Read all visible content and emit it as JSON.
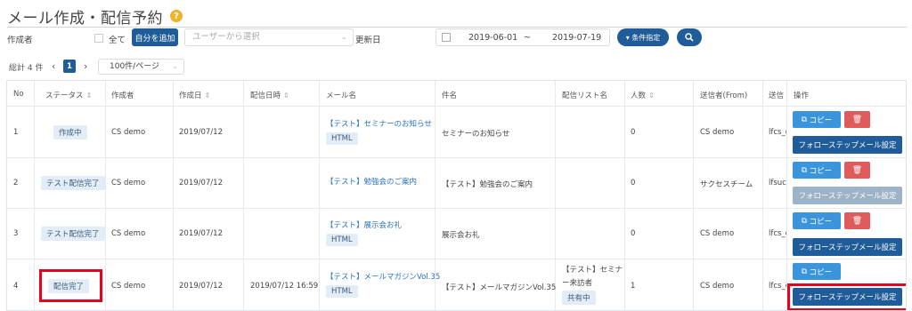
{
  "header": {
    "title": "メール作成・配信予約",
    "help": "?"
  },
  "filters": {
    "creator_label": "作成者",
    "all_label": "全て",
    "add_self_label": "自分を追加",
    "user_select_placeholder": "ユーザーから選択",
    "updated_label": "更新日",
    "date_from": "2019-06-01",
    "date_sep": "~",
    "date_to": "2019-07-19",
    "condition_label": "▾ 条件指定",
    "search_icon": "search-icon"
  },
  "pagination": {
    "total": "総計 4 件",
    "prev": "‹",
    "page": "1",
    "next": "›",
    "per_page": "100件/ページ"
  },
  "table": {
    "headers": {
      "no": "No",
      "status": "ステータス",
      "creator": "作成者",
      "created": "作成日",
      "sent_at": "配信日時",
      "mail_name": "メール名",
      "subject": "件名",
      "list": "配信リスト名",
      "count": "人数",
      "from": "送信者(From)",
      "to": "送信",
      "ops": "操作"
    },
    "rows": [
      {
        "no": "1",
        "status": "作成中",
        "creator": "CS demo",
        "created": "2019/07/12",
        "sent_at": "",
        "mail_name": "【テスト】セミナーのお知らせ",
        "format": "HTML",
        "subject": "セミナーのお知らせ",
        "list": "",
        "list2": "",
        "list_badge": "",
        "count": "0",
        "from": "CS demo",
        "to": "lfcs_d"
      },
      {
        "no": "2",
        "status": "テスト配信完了",
        "creator": "CS demo",
        "created": "2019/07/12",
        "sent_at": "",
        "mail_name": "【テスト】勉強会のご案内",
        "format": "",
        "subject": "【テスト】勉強会のご案内",
        "list": "",
        "list2": "",
        "list_badge": "",
        "count": "0",
        "from": "サクセスチーム",
        "to": "lfsuc"
      },
      {
        "no": "3",
        "status": "テスト配信完了",
        "creator": "CS demo",
        "created": "2019/07/12",
        "sent_at": "",
        "mail_name": "【テスト】展示会お礼",
        "format": "HTML",
        "subject": "展示会お礼",
        "list": "",
        "list2": "",
        "list_badge": "",
        "count": "0",
        "from": "CS demo",
        "to": "lfcs_d"
      },
      {
        "no": "4",
        "status": "配信完了",
        "creator": "CS demo",
        "created": "2019/07/12",
        "sent_at": "2019/07/12 16:59",
        "mail_name": "【テスト】メールマガジンVol.35",
        "format": "HTML",
        "subject": "【テスト】メールマガジンVol.35",
        "list": "【テスト】セミナ",
        "list2": "ー来訪者",
        "list_badge": "共有中",
        "count": "1",
        "from": "CS demo",
        "to": "lfcs_d"
      }
    ],
    "actions": {
      "copy": "コピー",
      "copy_icon": "copy-icon",
      "delete_icon": "trash-icon",
      "follow": "フォローステップメール設定"
    }
  },
  "colors": {
    "primary": "#1f5c99",
    "copy": "#3a95dd",
    "delete": "#e05c5c",
    "highlight": "#e8001c",
    "link": "#2a72c0"
  }
}
